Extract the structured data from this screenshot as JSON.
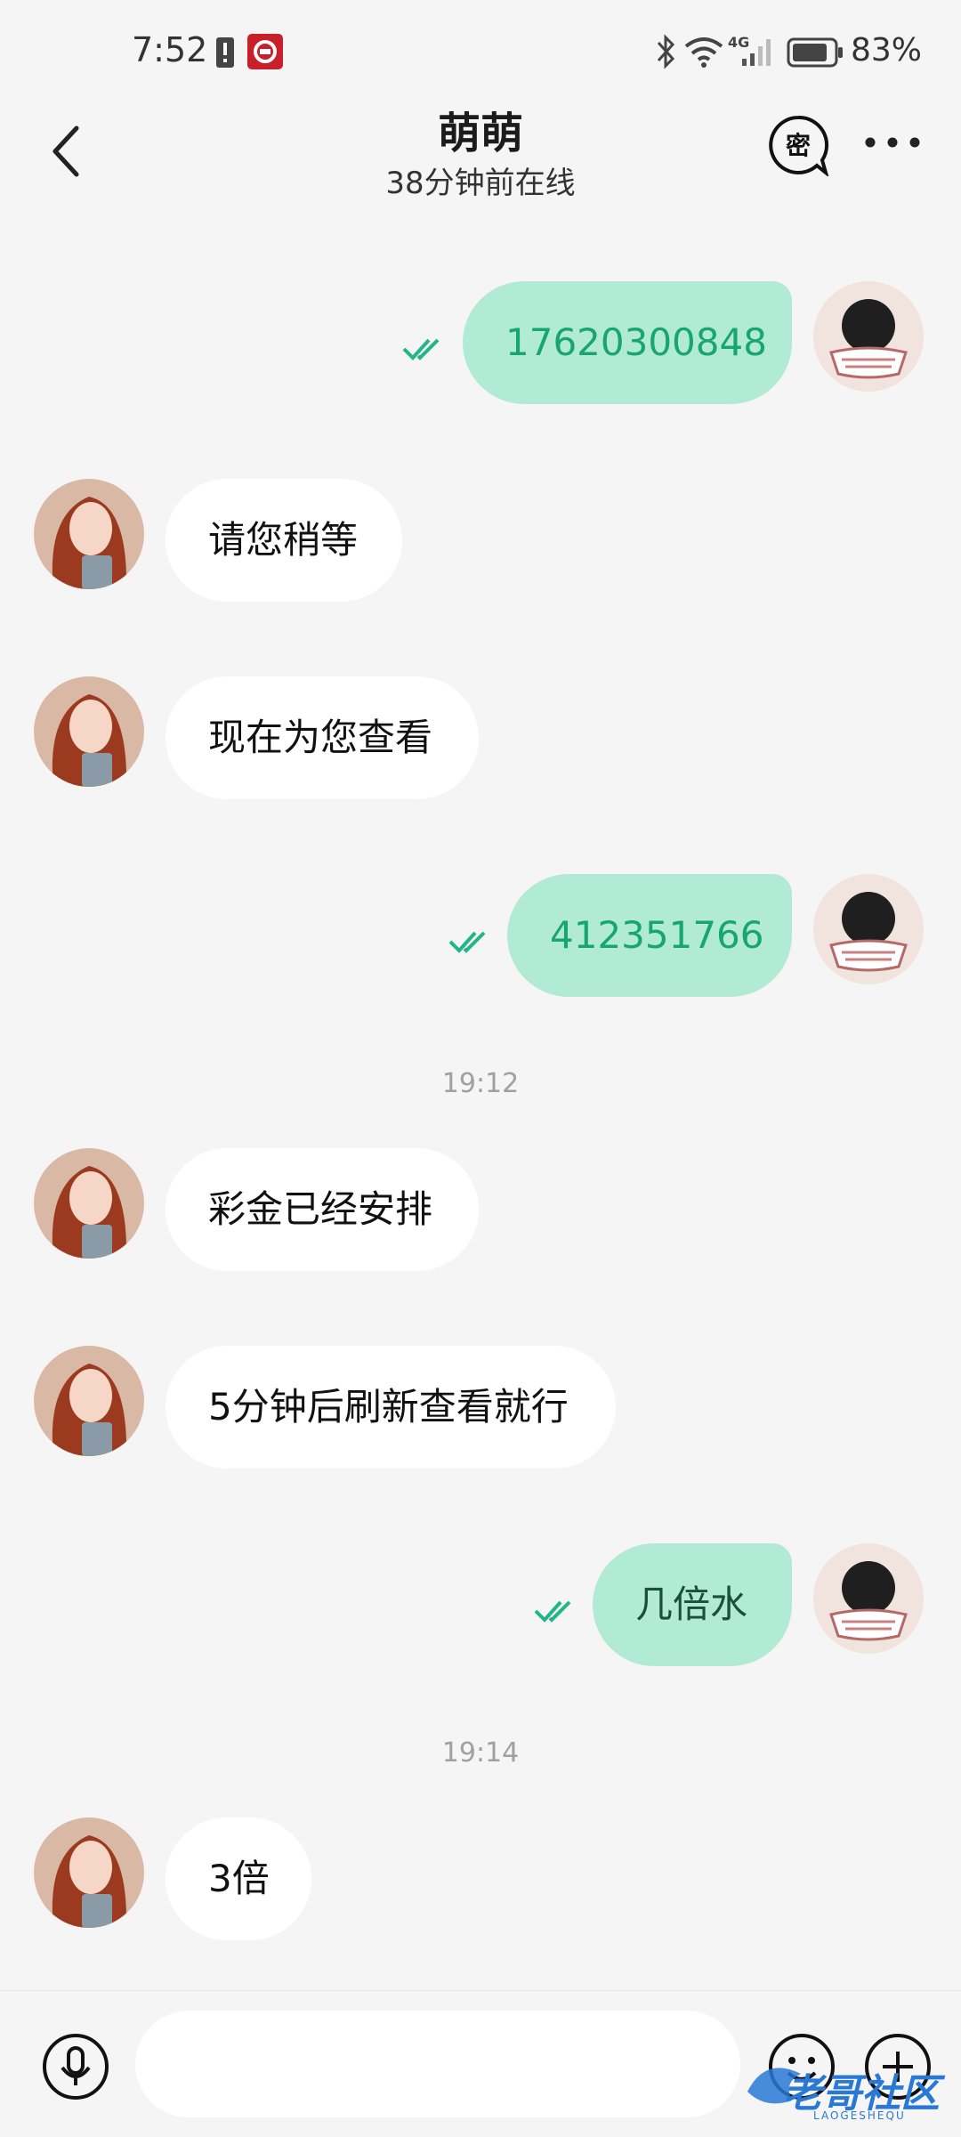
{
  "status_bar": {
    "time": "7:52",
    "network": "4G",
    "battery_percent": "83%",
    "icons": [
      "alert-icon",
      "bank-app-icon",
      "bluetooth-icon",
      "wifi-icon",
      "signal-icon",
      "battery-icon"
    ]
  },
  "header": {
    "title": "萌萌",
    "subtitle": "38分钟前在线",
    "secret_chat_label": "密",
    "icons": [
      "back-arrow-icon",
      "secret-chat-icon",
      "more-icon"
    ]
  },
  "messages": [
    {
      "direction": "out",
      "text": "17620300848",
      "read": true
    },
    {
      "direction": "in",
      "text": "请您稍等"
    },
    {
      "direction": "in",
      "text": "现在为您查看"
    },
    {
      "direction": "out",
      "text": "412351766",
      "read": true
    },
    {
      "type": "timestamp",
      "text": "19:12"
    },
    {
      "direction": "in",
      "text": "彩金已经安排"
    },
    {
      "direction": "in",
      "text": "5分钟后刷新查看就行"
    },
    {
      "direction": "out",
      "text": "几倍水",
      "read": true
    },
    {
      "type": "timestamp",
      "text": "19:14"
    },
    {
      "direction": "in",
      "text": "3倍"
    }
  ],
  "input_bar": {
    "placeholder": "",
    "icons": [
      "microphone-icon",
      "emoji-icon",
      "plus-icon"
    ]
  },
  "watermark": {
    "text": "老哥社区",
    "subtext": "LAOGESHEQU"
  },
  "colors": {
    "background": "#f5f5f5",
    "outgoing_bubble": "#b2ebd5",
    "outgoing_text": "#17a574",
    "incoming_bubble": "#ffffff",
    "read_check": "#22b585"
  }
}
